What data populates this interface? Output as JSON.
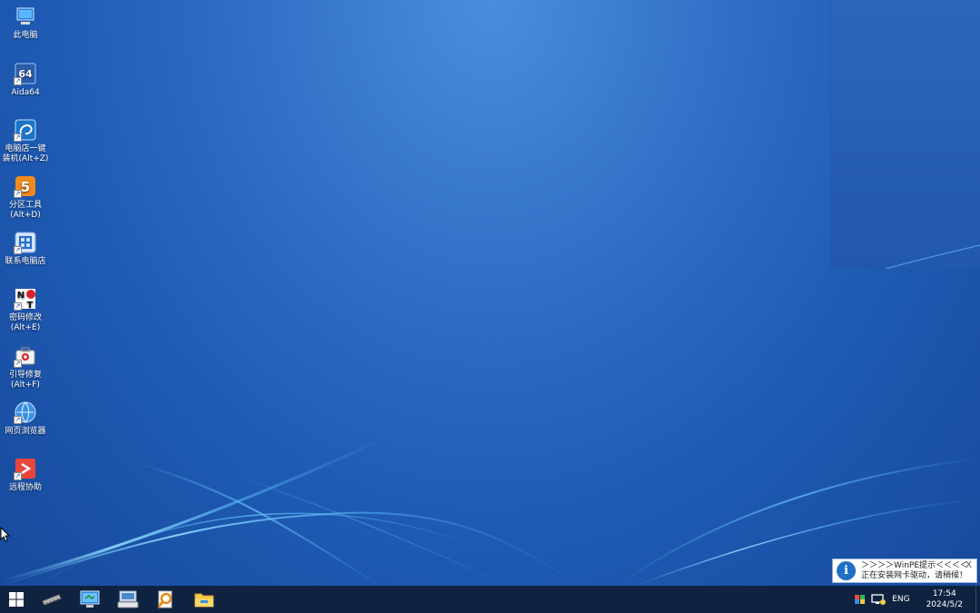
{
  "desktop_icons": [
    {
      "label": "此电脑",
      "icon": "computer-icon"
    },
    {
      "label": "Aida64",
      "icon": "aida64-icon"
    },
    {
      "label": "电脑店一键\n装机(Alt+Z)",
      "icon": "install-icon"
    },
    {
      "label": "分区工具\n(Alt+D)",
      "icon": "partition-icon"
    },
    {
      "label": "联系电脑店",
      "icon": "contact-icon"
    },
    {
      "label": "密码修改\n(Alt+E)",
      "icon": "password-icon"
    },
    {
      "label": "引导修复\n(Alt+F)",
      "icon": "boot-repair-icon"
    },
    {
      "label": "网页浏览器",
      "icon": "browser-icon"
    },
    {
      "label": "远程协助",
      "icon": "remote-assist-icon"
    }
  ],
  "notification": {
    "title": "＞＞＞＞WinPE提示＜＜＜＜",
    "message": "正在安装网卡驱动，请稍候！",
    "close": "X"
  },
  "taskbar": {
    "apps": [
      "start-icon",
      "memory-icon",
      "monitor-icon",
      "keyboard-icon",
      "search-tool-icon",
      "folder-icon"
    ]
  },
  "tray": {
    "language": "ENG",
    "time": "17:54",
    "date": "2024/5/2"
  },
  "colors": {
    "desktop": "#2f6fc6",
    "taskbar": "#0f2340",
    "accent": "#1e6fc5"
  }
}
